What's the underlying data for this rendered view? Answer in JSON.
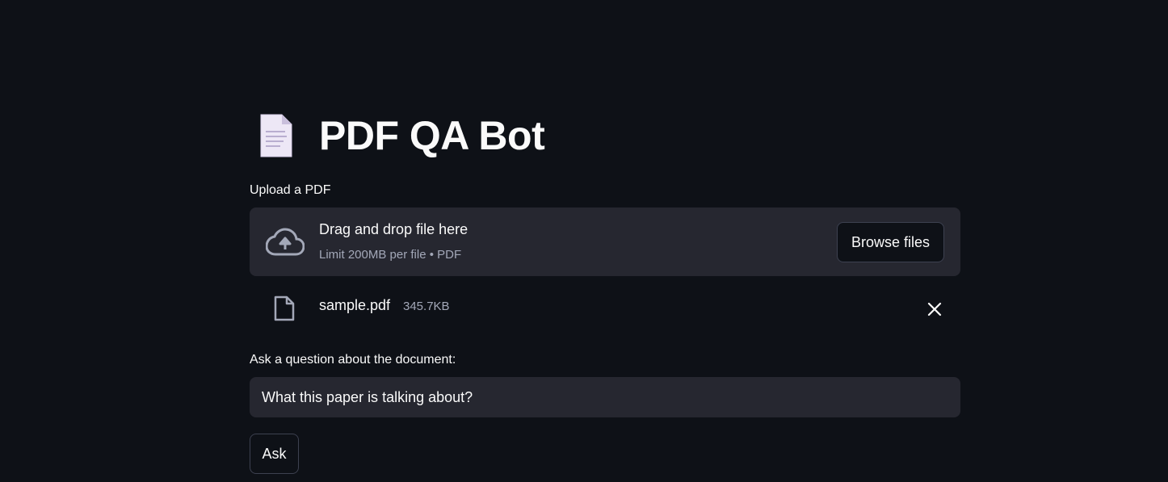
{
  "header": {
    "title": "PDF QA Bot",
    "emoji_icon": "page-facing-up-icon"
  },
  "uploader": {
    "label": "Upload a PDF",
    "drop_text": "Drag and drop file here",
    "limit_text": "Limit 200MB per file • PDF",
    "browse_label": "Browse files",
    "icon": "cloud-upload-icon"
  },
  "uploaded_file": {
    "name": "sample.pdf",
    "size": "345.7KB",
    "icon": "file-icon",
    "remove_icon": "close-icon"
  },
  "question": {
    "label": "Ask a question about the document:",
    "value": "What this paper is talking about?"
  },
  "ask_button": {
    "label": "Ask"
  },
  "colors": {
    "background": "#0e1117",
    "surface": "#262730",
    "text": "#fafafa",
    "muted": "#a3a8b8",
    "border": "#3d4150"
  }
}
